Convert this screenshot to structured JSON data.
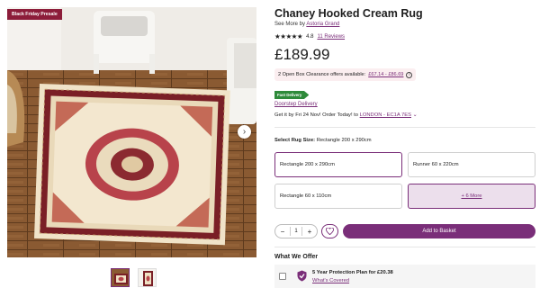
{
  "gallery": {
    "badge": "Black Friday Presale",
    "next_icon": "chevron-right-icon",
    "thumbnails": 2
  },
  "product": {
    "title": "Chaney Hooked Cream Rug",
    "see_more_prefix": "See More by",
    "brand": "Astoria Grand",
    "rating": "4.8",
    "stars": "★★★★★",
    "reviews": "11 Reviews",
    "price": "£189.99"
  },
  "openbox": {
    "text": "2 Open Box Clearance offers available:",
    "range": "£67.14 - £86.69",
    "icon": "info-icon"
  },
  "delivery": {
    "tag": "Fast Delivery",
    "type": "Doorstep Delivery",
    "get_it_by": "Get it by Fri 24 Nov! Order Today! to",
    "postcode": "LONDON - EC1A 7ES",
    "chevron": "⌄"
  },
  "size": {
    "label": "Select Rug Size:",
    "selected_value": "Rectangle 200 x 290cm",
    "options": [
      "Rectangle 200 x 290cm",
      "Runner 60 x 220cm",
      "Rectangle 60 x 110cm",
      "+ 6 More"
    ]
  },
  "cart": {
    "qty_minus": "−",
    "qty_value": "1",
    "qty_plus": "+",
    "add_label": "Add to Basket"
  },
  "offers": {
    "heading": "What We Offer",
    "plan": "5 Year Protection Plan for £20.38",
    "covered": "What's Covered"
  },
  "colors": {
    "accent": "#7a2e79",
    "badge": "#8c1d3a",
    "fast_delivery": "#2e8a3a"
  }
}
